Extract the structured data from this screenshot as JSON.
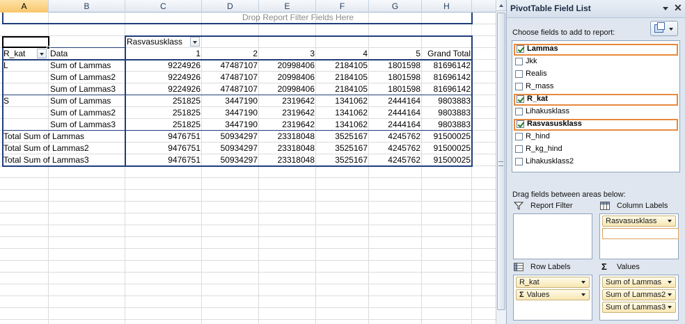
{
  "sheet": {
    "columns": [
      "A",
      "B",
      "C",
      "D",
      "E",
      "F",
      "G",
      "H"
    ],
    "drop_filter_hint": "Drop Report Filter Fields Here",
    "pivot": {
      "column_field": "Rasvasusklass",
      "row_field": "R_kat",
      "data_label": "Data",
      "col_labels": [
        "1",
        "2",
        "3",
        "4",
        "5",
        "Grand Total"
      ],
      "rows": [
        {
          "group": "L",
          "label": "Sum of Lammas",
          "values": [
            "9224926",
            "47487107",
            "20998406",
            "2184105",
            "1801598",
            "81696142"
          ]
        },
        {
          "group": "",
          "label": "Sum of Lammas2",
          "values": [
            "9224926",
            "47487107",
            "20998406",
            "2184105",
            "1801598",
            "81696142"
          ]
        },
        {
          "group": "",
          "label": "Sum of Lammas3",
          "values": [
            "9224926",
            "47487107",
            "20998406",
            "2184105",
            "1801598",
            "81696142"
          ]
        },
        {
          "group": "S",
          "label": "Sum of Lammas",
          "values": [
            "251825",
            "3447190",
            "2319642",
            "1341062",
            "2444164",
            "9803883"
          ]
        },
        {
          "group": "",
          "label": "Sum of Lammas2",
          "values": [
            "251825",
            "3447190",
            "2319642",
            "1341062",
            "2444164",
            "9803883"
          ]
        },
        {
          "group": "",
          "label": "Sum of Lammas3",
          "values": [
            "251825",
            "3447190",
            "2319642",
            "1341062",
            "2444164",
            "9803883"
          ]
        }
      ],
      "totals": [
        {
          "label": "Total Sum of Lammas",
          "values": [
            "9476751",
            "50934297",
            "23318048",
            "3525167",
            "4245762",
            "91500025"
          ]
        },
        {
          "label": "Total Sum of Lammas2",
          "values": [
            "9476751",
            "50934297",
            "23318048",
            "3525167",
            "4245762",
            "91500025"
          ]
        },
        {
          "label": "Total Sum of Lammas3",
          "values": [
            "9476751",
            "50934297",
            "23318048",
            "3525167",
            "4245762",
            "91500025"
          ]
        }
      ]
    }
  },
  "field_list": {
    "title": "PivotTable Field List",
    "choose_label": "Choose fields to add to report:",
    "fields": [
      {
        "name": "Lammas",
        "checked": true
      },
      {
        "name": "Jkk",
        "checked": false
      },
      {
        "name": "Realis",
        "checked": false
      },
      {
        "name": "R_mass",
        "checked": false
      },
      {
        "name": "R_kat",
        "checked": true
      },
      {
        "name": "Lihakusklass",
        "checked": false
      },
      {
        "name": "Rasvasusklass",
        "checked": true
      },
      {
        "name": "R_hind",
        "checked": false
      },
      {
        "name": "R_kg_hind",
        "checked": false
      },
      {
        "name": "Lihakusklass2",
        "checked": false
      }
    ],
    "drag_label": "Drag fields between areas below:",
    "areas": {
      "report_filter": "Report Filter",
      "column_labels": "Column Labels",
      "row_labels": "Row Labels",
      "values": "Values",
      "column_items": [
        "Rasvasusklass"
      ],
      "row_items": [
        "R_kat",
        "Values"
      ],
      "value_items": [
        "Sum of Lammas",
        "Sum of Lammas2",
        "Sum of Lammas3"
      ]
    }
  }
}
